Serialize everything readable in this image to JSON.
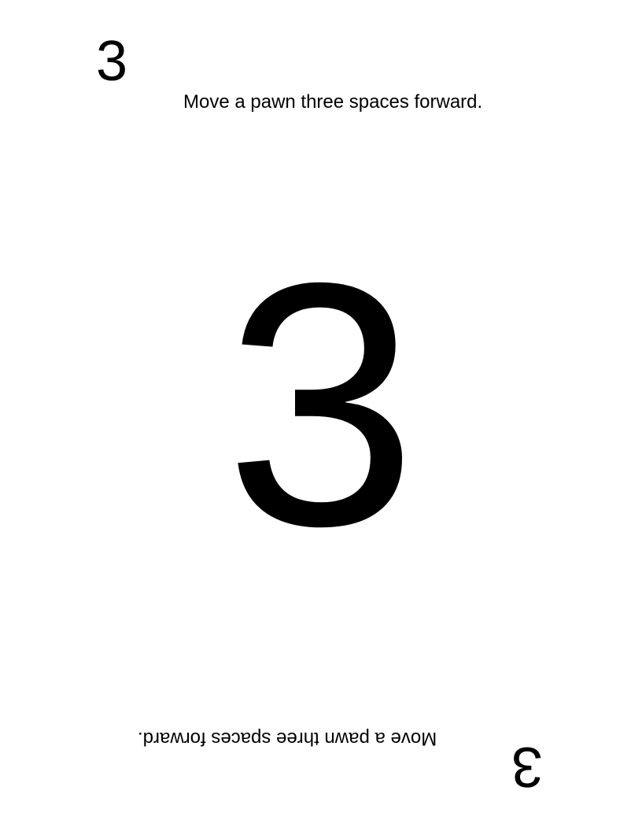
{
  "card": {
    "value": "3",
    "instruction": "Move a pawn three spaces forward."
  }
}
